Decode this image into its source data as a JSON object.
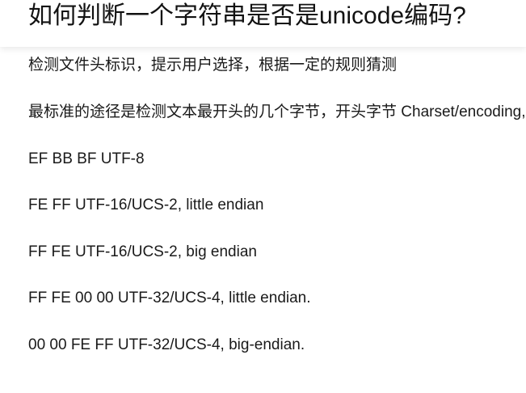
{
  "question": {
    "title": "如何判断一个字符串是否是unicode编码?"
  },
  "answer": {
    "paragraphs": [
      "检测文件头标识，提示用户选择，根据一定的规则猜测",
      "最标准的途径是检测文本最开头的几个字节，开头字节 Charset/encoding,如下表：",
      "EF BB BF UTF-8",
      "FE FF UTF-16/UCS-2, little endian",
      "FF FE UTF-16/UCS-2, big endian",
      "FF FE 00 00 UTF-32/UCS-4, little endian.",
      "00 00 FE FF UTF-32/UCS-4, big-endian."
    ]
  }
}
